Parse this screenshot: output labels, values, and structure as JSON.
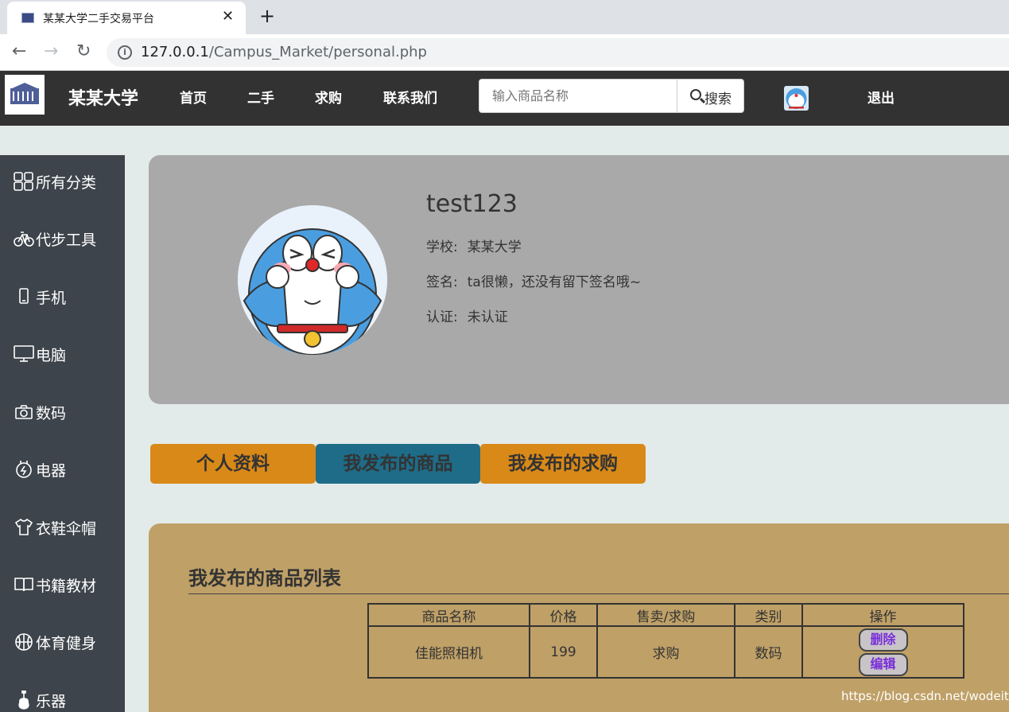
{
  "browser": {
    "tab_title": "某某大学二手交易平台",
    "url_host": "127.0.0.1",
    "url_path": "/Campus_Market/personal.php"
  },
  "nav": {
    "brand": "某某大学",
    "links": [
      "首页",
      "二手",
      "求购",
      "联系我们"
    ],
    "search_placeholder": "输入商品名称",
    "search_button": "搜索",
    "logout": "退出"
  },
  "sidebar": {
    "items": [
      {
        "label": "所有分类",
        "icon": "grid-icon"
      },
      {
        "label": "代步工具",
        "icon": "bicycle-icon"
      },
      {
        "label": "手机",
        "icon": "phone-icon"
      },
      {
        "label": "电脑",
        "icon": "monitor-icon"
      },
      {
        "label": "数码",
        "icon": "camera-icon"
      },
      {
        "label": "电器",
        "icon": "power-icon"
      },
      {
        "label": "衣鞋伞帽",
        "icon": "shirt-icon"
      },
      {
        "label": "书籍教材",
        "icon": "book-icon"
      },
      {
        "label": "体育健身",
        "icon": "basketball-icon"
      },
      {
        "label": "乐器",
        "icon": "guitar-icon"
      }
    ]
  },
  "profile": {
    "username": "test123",
    "school_key": "学校:",
    "school_val": "某某大学",
    "sign_key": "签名:",
    "sign_val": "ta很懒，还没有留下签名哦~",
    "cert_key": "认证:",
    "cert_val": "未认证"
  },
  "tabs": [
    "个人资料",
    "我发布的商品",
    "我发布的求购"
  ],
  "goods": {
    "title": "我发布的商品列表",
    "headers": [
      "商品名称",
      "价格",
      "售卖/求购",
      "类别",
      "操作"
    ],
    "rows": [
      {
        "name": "佳能照相机",
        "price": "199",
        "type": "求购",
        "category": "数码"
      }
    ],
    "delete_label": "删除",
    "edit_label": "编辑"
  },
  "watermark": "https://blog.csdn.net/wodeita",
  "colors": {
    "nav_bg": "#323232",
    "sidebar_bg": "#3e444b",
    "profile_bg": "#a9a9a9",
    "tab_orange": "#d98918",
    "tab_blue": "#1e6c88",
    "panel_bg": "#bfa067",
    "button_text": "#7a2ed8"
  }
}
